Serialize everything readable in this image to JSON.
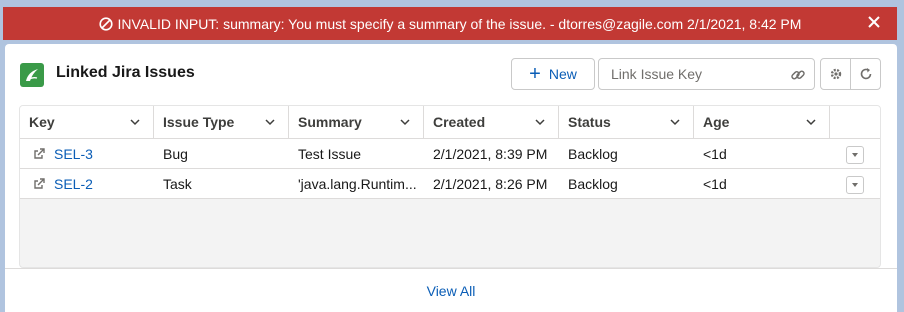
{
  "error": {
    "message": "INVALID INPUT: summary: You must specify a summary of the issue.  -  dtorres@zagile.com 2/1/2021, 8:42 PM"
  },
  "card": {
    "title": "Linked Jira Issues",
    "new_label": "New",
    "link_placeholder": "Link Issue Key",
    "view_all": "View All"
  },
  "table": {
    "columns": [
      "Key",
      "Issue Type",
      "Summary",
      "Created",
      "Status",
      "Age"
    ],
    "rows": [
      {
        "key": "SEL-3",
        "type": "Bug",
        "summary": "Test Issue",
        "created": "2/1/2021, 8:39 PM",
        "status": "Backlog",
        "age": "<1d"
      },
      {
        "key": "SEL-2",
        "type": "Task",
        "summary": "'java.lang.Runtim...",
        "created": "2/1/2021, 8:26 PM",
        "status": "Backlog",
        "age": "<1d"
      }
    ]
  },
  "icons": {
    "error": "ban-icon",
    "close": "close-icon",
    "logo": "jira-logo-icon",
    "link": "link-icon",
    "settings": "gear-icon",
    "refresh": "refresh-icon",
    "sort": "chevron-down-icon",
    "open_external": "external-link-icon",
    "row_menu": "caret-down-icon"
  },
  "colors": {
    "error_bg": "#c23934",
    "link": "#0a5db6",
    "logo": "#3a9a48",
    "page_bg": "#b0c4df"
  }
}
